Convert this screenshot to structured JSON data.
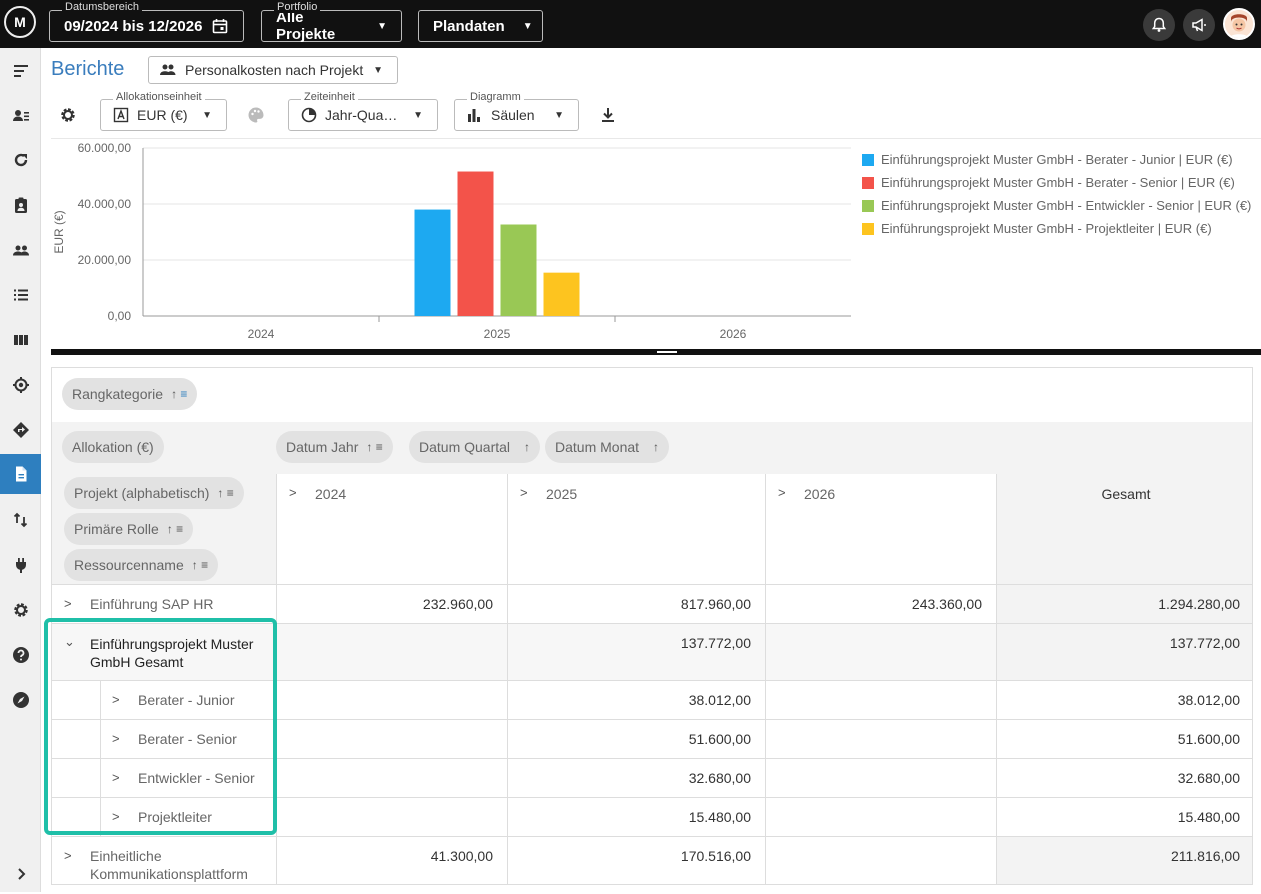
{
  "topbar": {
    "logo_text": "M",
    "date_range": {
      "label": "Datumsbereich",
      "value": "09/2024 bis 12/2026"
    },
    "portfolio": {
      "label": "Portfolio",
      "value": "Alle Projekte"
    },
    "plan": {
      "value": "Plandaten"
    }
  },
  "header": {
    "title": "Berichte",
    "report": "Personalkosten nach Projekt"
  },
  "controls": {
    "allocation": {
      "label": "Allokationseinheit",
      "value": "EUR (€)"
    },
    "timeunit": {
      "label": "Zeiteinheit",
      "value": "Jahr-Qua…"
    },
    "diagram": {
      "label": "Diagramm",
      "value": "Säulen"
    }
  },
  "chart_data": {
    "type": "bar",
    "categories": [
      "2024",
      "2025",
      "2026"
    ],
    "ylabel": "EUR (€)",
    "ylim": [
      0,
      60000
    ],
    "yticks": [
      "0,00",
      "20.000,00",
      "40.000,00",
      "60.000,00"
    ],
    "legend_position": "right",
    "series": [
      {
        "name": "Einführungsprojekt Muster GmbH - Berater - Junior | EUR (€)",
        "color": "#1da9f1",
        "values": [
          0,
          38012,
          0
        ]
      },
      {
        "name": "Einführungsprojekt Muster GmbH - Berater - Senior | EUR (€)",
        "color": "#f3534a",
        "values": [
          0,
          51600,
          0
        ]
      },
      {
        "name": "Einführungsprojekt Muster GmbH - Entwickler - Senior | EUR (€)",
        "color": "#99c855",
        "values": [
          0,
          32680,
          0
        ]
      },
      {
        "name": "Einführungsprojekt Muster GmbH - Projektleiter | EUR (€)",
        "color": "#fdc41f",
        "values": [
          0,
          15480,
          0
        ]
      }
    ]
  },
  "pivot": {
    "filter_chip": "Rangkategorie",
    "value_chip": "Allokation (€)",
    "column_chips": [
      "Datum Jahr",
      "Datum Quartal",
      "Datum Monat"
    ],
    "row_chips": [
      "Projekt (alphabetisch)",
      "Primäre Rolle",
      "Ressourcenname"
    ],
    "columns": [
      "2024",
      "2025",
      "2026"
    ],
    "total_label": "Gesamt",
    "rows": [
      {
        "label": "Einführung SAP HR",
        "values": [
          "232.960,00",
          "817.960,00",
          "243.360,00"
        ],
        "total": "1.294.280,00"
      },
      {
        "label": "Einführungsprojekt Muster GmbH Gesamt",
        "values": [
          "",
          "137.772,00",
          ""
        ],
        "total": "137.772,00"
      },
      {
        "label": "Berater - Junior",
        "values": [
          "",
          "38.012,00",
          ""
        ],
        "total": "38.012,00"
      },
      {
        "label": "Berater - Senior",
        "values": [
          "",
          "51.600,00",
          ""
        ],
        "total": "51.600,00"
      },
      {
        "label": "Entwickler - Senior",
        "values": [
          "",
          "32.680,00",
          ""
        ],
        "total": "32.680,00"
      },
      {
        "label": "Projektleiter",
        "values": [
          "",
          "15.480,00",
          ""
        ],
        "total": "15.480,00"
      },
      {
        "label": "Einheitliche Kommunikationsplattform",
        "values": [
          "41.300,00",
          "170.516,00",
          ""
        ],
        "total": "211.816,00"
      }
    ]
  }
}
